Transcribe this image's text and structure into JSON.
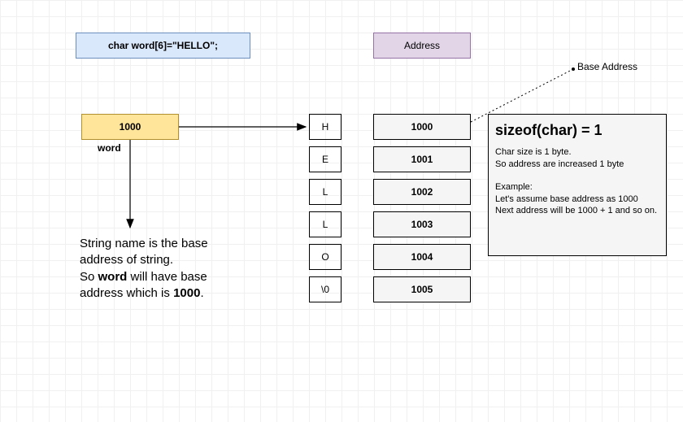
{
  "declaration": "char word[6]=\"HELLO\";",
  "address_header": "Address",
  "pointer_value": "1000",
  "pointer_label": "word",
  "base_address_label": "Base Address",
  "cells": [
    {
      "char": "H",
      "addr": "1000"
    },
    {
      "char": "E",
      "addr": "1001"
    },
    {
      "char": "L",
      "addr": "1002"
    },
    {
      "char": "L",
      "addr": "1003"
    },
    {
      "char": "O",
      "addr": "1004"
    },
    {
      "char": "\\0",
      "addr": "1005"
    }
  ],
  "note": {
    "title": "sizeof(char) = 1",
    "line1": "Char size is 1 byte.",
    "line2": "So address are increased 1 byte",
    "example_header": "Example:",
    "line3": "Let's assume base address as 1000",
    "line4": "Next address will be 1000 + 1 and so on."
  },
  "explanation": {
    "part1": "String name is the base address of string.",
    "part2a": "So ",
    "bold1": "word",
    "part2b": " will have base address which is ",
    "bold2": "1000",
    "part2c": "."
  }
}
